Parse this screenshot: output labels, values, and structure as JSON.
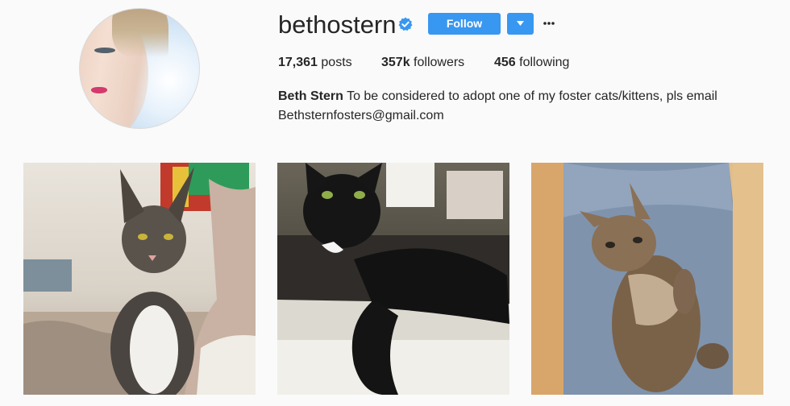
{
  "profile": {
    "username": "bethostern",
    "verified": true,
    "follow_label": "Follow",
    "avatar_icon": "profile-photo",
    "verified_icon": "verified-badge-icon",
    "dropdown_icon": "chevron-down-icon",
    "more_icon": "more-options-icon"
  },
  "stats": {
    "posts_count": "17,361",
    "posts_label": "posts",
    "followers_count": "357k",
    "followers_label": "followers",
    "following_count": "456",
    "following_label": "following"
  },
  "bio": {
    "name": "Beth Stern",
    "text": "To be considered to adopt one of my foster cats/kittens, pls email",
    "email": "Bethsternfosters@gmail.com"
  },
  "posts": [
    {
      "subject": "tabby-and-white cat sitting on a bed"
    },
    {
      "subject": "black cat lying on a windowsill"
    },
    {
      "subject": "tabby kitten lying on a lap in jeans"
    }
  ],
  "colors": {
    "accent": "#3897f0",
    "verified": "#3897f0",
    "text": "#262626",
    "background": "#fafafa"
  }
}
